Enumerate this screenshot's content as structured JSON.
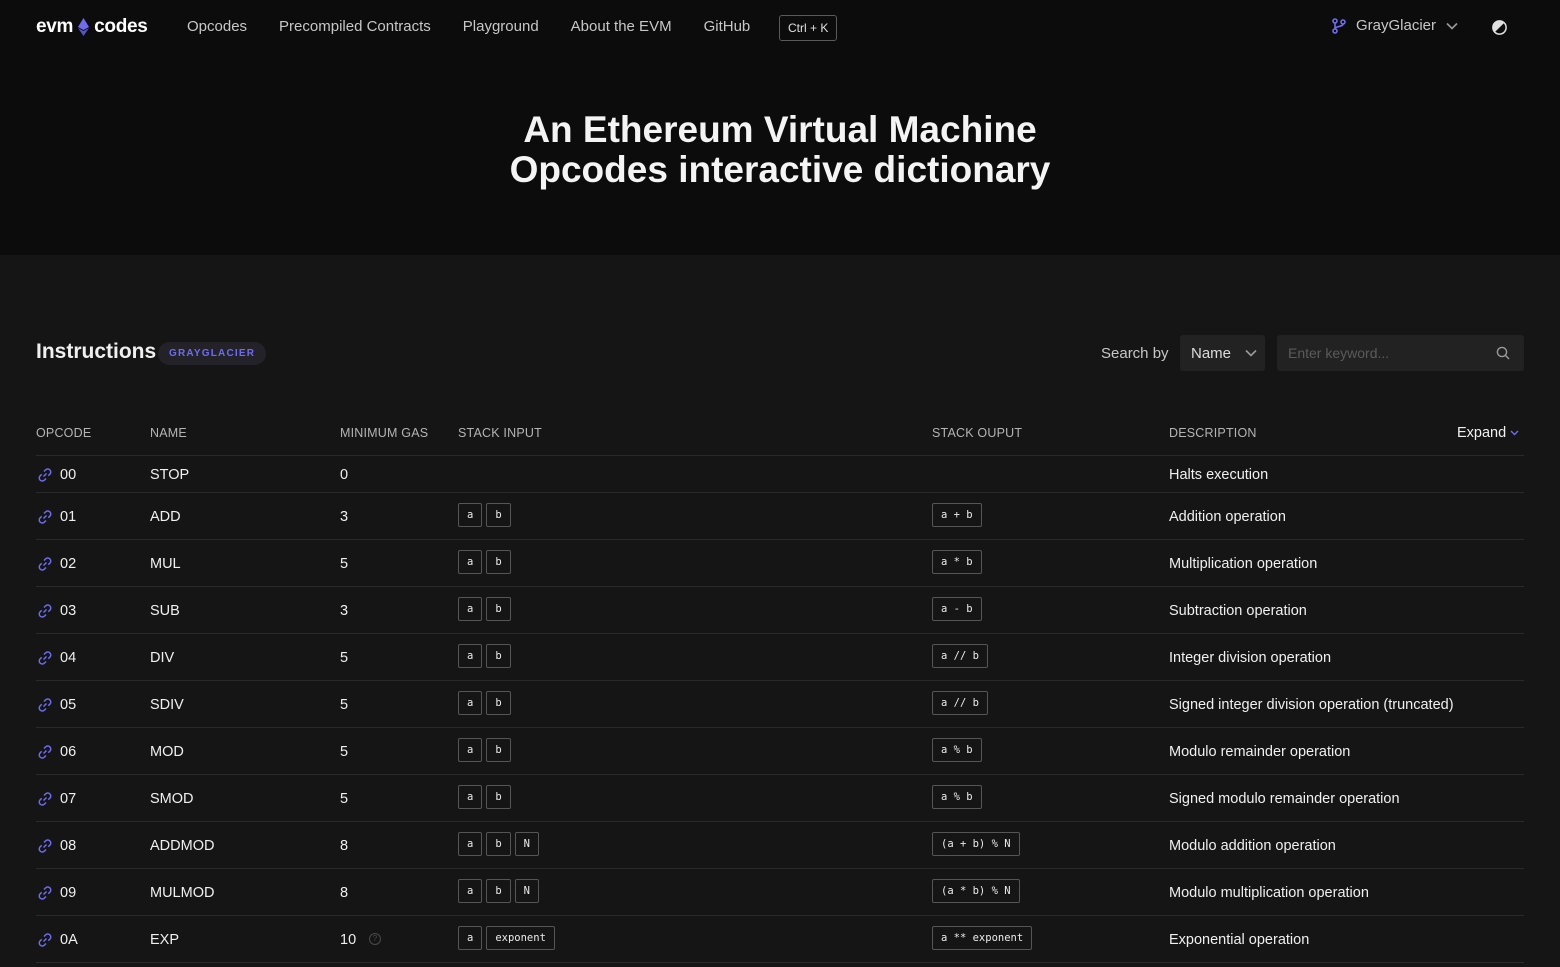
{
  "brand": {
    "part1": "evm",
    "part2": "codes"
  },
  "nav": {
    "links": [
      "Opcodes",
      "Precompiled Contracts",
      "Playground",
      "About the EVM",
      "GitHub"
    ],
    "shortcut": "Ctrl + K",
    "fork": "GrayGlacier"
  },
  "hero": {
    "line1": "An Ethereum Virtual Machine",
    "line2": "Opcodes interactive dictionary"
  },
  "instructions": {
    "title": "Instructions",
    "fork_badge": "GRAYGLACIER",
    "search_by_label": "Search by",
    "search_by_value": "Name",
    "search_placeholder": "Enter keyword..."
  },
  "table": {
    "headers": {
      "opcode": "OPCODE",
      "name": "NAME",
      "gas": "MINIMUM GAS",
      "input": "STACK INPUT",
      "output": "STACK OUPUT",
      "description": "DESCRIPTION"
    },
    "expand_label": "Expand",
    "rows": [
      {
        "opcode": "00",
        "name": "STOP",
        "gas": "0",
        "input": [],
        "output": [],
        "description": "Halts execution"
      },
      {
        "opcode": "01",
        "name": "ADD",
        "gas": "3",
        "input": [
          "a",
          "b"
        ],
        "output": [
          "a + b"
        ],
        "description": "Addition operation"
      },
      {
        "opcode": "02",
        "name": "MUL",
        "gas": "5",
        "input": [
          "a",
          "b"
        ],
        "output": [
          "a * b"
        ],
        "description": "Multiplication operation"
      },
      {
        "opcode": "03",
        "name": "SUB",
        "gas": "3",
        "input": [
          "a",
          "b"
        ],
        "output": [
          "a - b"
        ],
        "description": "Subtraction operation"
      },
      {
        "opcode": "04",
        "name": "DIV",
        "gas": "5",
        "input": [
          "a",
          "b"
        ],
        "output": [
          "a // b"
        ],
        "description": "Integer division operation"
      },
      {
        "opcode": "05",
        "name": "SDIV",
        "gas": "5",
        "input": [
          "a",
          "b"
        ],
        "output": [
          "a // b"
        ],
        "description": "Signed integer division operation (truncated)"
      },
      {
        "opcode": "06",
        "name": "MOD",
        "gas": "5",
        "input": [
          "a",
          "b"
        ],
        "output": [
          "a % b"
        ],
        "description": "Modulo remainder operation"
      },
      {
        "opcode": "07",
        "name": "SMOD",
        "gas": "5",
        "input": [
          "a",
          "b"
        ],
        "output": [
          "a % b"
        ],
        "description": "Signed modulo remainder operation"
      },
      {
        "opcode": "08",
        "name": "ADDMOD",
        "gas": "8",
        "input": [
          "a",
          "b",
          "N"
        ],
        "output": [
          "(a + b) % N"
        ],
        "description": "Modulo addition operation"
      },
      {
        "opcode": "09",
        "name": "MULMOD",
        "gas": "8",
        "input": [
          "a",
          "b",
          "N"
        ],
        "output": [
          "(a * b) % N"
        ],
        "description": "Modulo multiplication operation"
      },
      {
        "opcode": "0A",
        "name": "EXP",
        "gas": "10",
        "gas_help": "?",
        "input": [
          "a",
          "exponent"
        ],
        "output": [
          "a ** exponent"
        ],
        "description": "Exponential operation"
      }
    ]
  }
}
